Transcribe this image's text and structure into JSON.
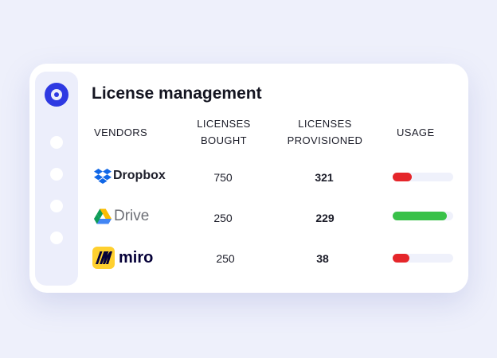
{
  "title": "License management",
  "columns": {
    "vendors": "VENDORS",
    "bought_l1": "LICENSES",
    "bought_l2": "BOUGHT",
    "provisioned_l1": "LICENSES",
    "provisioned_l2": "PROVISIONED",
    "usage": "USAGE"
  },
  "rows": [
    {
      "vendor": "Dropbox",
      "icon": "dropbox-icon",
      "bought": "750",
      "provisioned": "321",
      "usage": 0.32,
      "usage_color": "#e5262a"
    },
    {
      "vendor": "Drive",
      "icon": "google-drive-icon",
      "bought": "250",
      "provisioned": "229",
      "usage": 0.9,
      "usage_color": "#39c149"
    },
    {
      "vendor": "miro",
      "icon": "miro-icon",
      "bought": "250",
      "provisioned": "38",
      "usage": 0.27,
      "usage_color": "#e5262a"
    }
  ],
  "colors": {
    "accent": "#2e39e2",
    "rail": "#eceefb",
    "background": "#eef0fb"
  }
}
